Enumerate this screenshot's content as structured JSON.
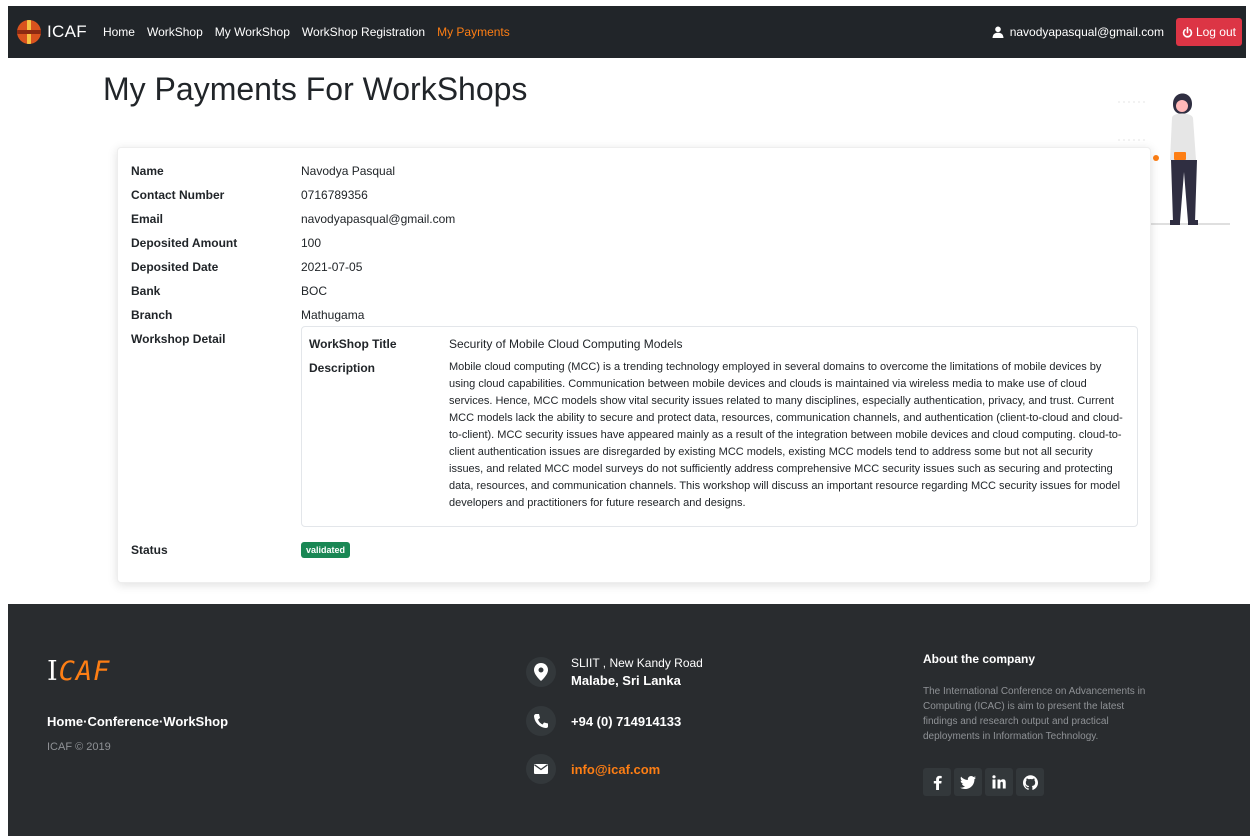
{
  "navbar": {
    "brand": "ICAF",
    "links": [
      "Home",
      "WorkShop",
      "My WorkShop",
      "WorkShop Registration",
      "My Payments"
    ],
    "active_index": 4,
    "user_email": "navodyapasqual@gmail.com",
    "logout_label": "Log out"
  },
  "page": {
    "title": "My Payments For WorkShops"
  },
  "payment": {
    "fields": [
      {
        "label": "Name",
        "value": "Navodya Pasqual"
      },
      {
        "label": "Contact Number",
        "value": "0716789356"
      },
      {
        "label": "Email",
        "value": "navodyapasqual@gmail.com"
      },
      {
        "label": "Deposited Amount",
        "value": "100"
      },
      {
        "label": "Deposited Date",
        "value": "2021-07-05"
      },
      {
        "label": "Bank",
        "value": "BOC"
      },
      {
        "label": "Branch",
        "value": "Mathugama"
      }
    ],
    "workshop_detail_label": "Workshop Detail",
    "workshop": {
      "title_label": "WorkShop Title",
      "title": "Security of Mobile Cloud Computing Models",
      "description_label": "Description",
      "description": "Mobile cloud computing (MCC) is a trending technology employed in several domains to overcome the limitations of mobile devices by using cloud capabilities. Communication between mobile devices and clouds is maintained via wireless media to make use of cloud services. Hence, MCC models show vital security issues related to many disciplines, especially authentication, privacy, and trust. Current MCC models lack the ability to secure and protect data, resources, communication channels, and authentication (client-to-cloud and cloud-to-client). MCC security issues have appeared mainly as a result of the integration between mobile devices and cloud computing. cloud-to-client authentication issues are disregarded by existing MCC models, existing MCC models tend to address some but not all security issues, and related MCC model surveys do not sufficiently address comprehensive MCC security issues such as securing and protecting data, resources, and communication channels. This workshop will discuss an important resource regarding MCC security issues for model developers and practitioners for future research and designs."
    },
    "status_label": "Status",
    "status": "validated"
  },
  "footer": {
    "logo_i": "I",
    "logo_caf": "CAF",
    "links": "Home·Conference·WorkShop",
    "copyright": "ICAF © 2019",
    "address_line1": "SLIIT , New Kandy Road",
    "address_line2": "Malabe, Sri Lanka",
    "phone": "+94 (0) 714914133",
    "email": "info@icaf.com",
    "about_title": "About the company",
    "about_text": "The International Conference on Advancements in Computing (ICAC) is aim to present the latest findings and research output and practical deployments in Information Technology.",
    "socials": [
      "facebook",
      "twitter",
      "linkedin",
      "github"
    ]
  },
  "colors": {
    "accent": "#fd7e14",
    "danger": "#dc3545",
    "success": "#198754",
    "dark": "#212529",
    "footer": "#292c2f"
  }
}
